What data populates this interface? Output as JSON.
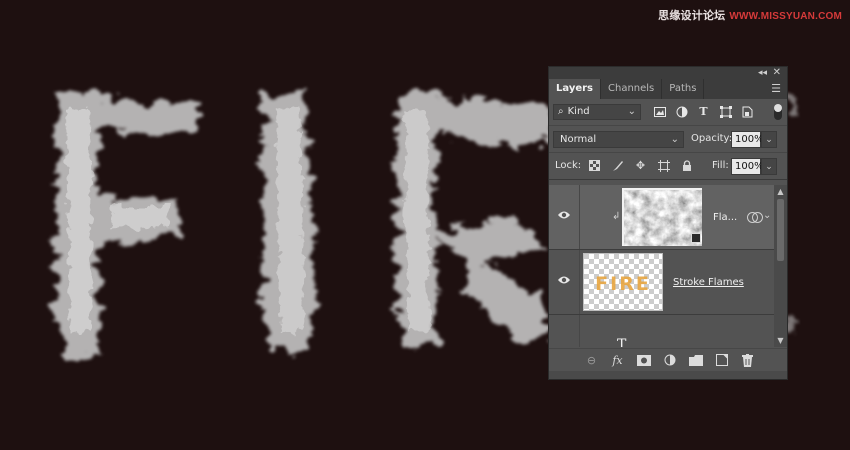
{
  "canvas": {
    "background": "#1e1010",
    "text_letters": [
      "F",
      "I",
      "R"
    ]
  },
  "watermark": {
    "text": "思缘设计论坛",
    "site": "WWW.MISSYUAN.COM"
  },
  "panel": {
    "tabs": [
      {
        "label": "Layers",
        "active": true
      },
      {
        "label": "Channels",
        "active": false
      },
      {
        "label": "Paths",
        "active": false
      }
    ],
    "filter": {
      "kind_label": "Kind",
      "icons": [
        "image-filter-icon",
        "adjustment-filter-icon",
        "type-filter-icon",
        "shape-filter-icon",
        "smart-object-filter-icon"
      ]
    },
    "blend_mode": "Normal",
    "opacity_label": "Opacity:",
    "opacity_value": "100%",
    "lock_label": "Lock:",
    "lock_icons": [
      "lock-transparent-pixels-icon",
      "lock-image-pixels-icon",
      "lock-position-icon",
      "lock-artboard-icon",
      "lock-all-icon"
    ],
    "fill_label": "Fill:",
    "fill_value": "100%",
    "layers": [
      {
        "name": "Fla...",
        "selected": true,
        "clipped": true,
        "smart_object": true
      },
      {
        "name": "Stroke Flames",
        "selected": false,
        "clipped": false,
        "smart_object": false,
        "thumb_text": "FIRE"
      },
      {
        "name": "T",
        "selected": false,
        "partial": true
      }
    ],
    "bottom_icons": [
      "link-layers-icon",
      "fx-icon",
      "add-mask-icon",
      "adjustment-layer-icon",
      "group-folder-icon",
      "new-layer-icon",
      "delete-layer-icon"
    ],
    "accent": "#e8a640"
  }
}
